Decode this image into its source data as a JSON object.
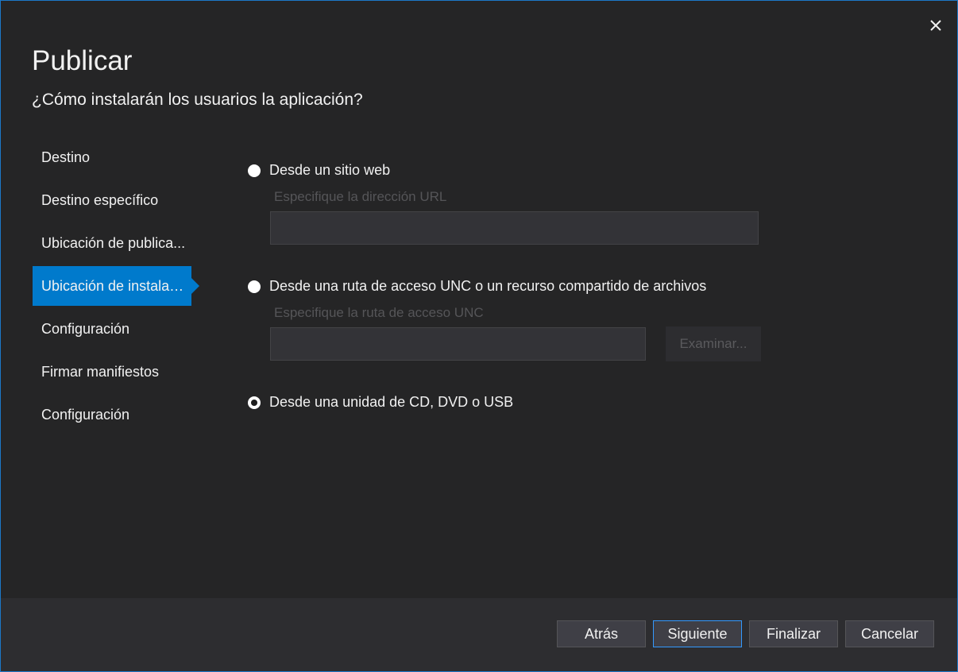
{
  "dialog": {
    "title": "Publicar",
    "subtitle": "¿Cómo instalarán los usuarios la aplicación?"
  },
  "sidebar": {
    "items": [
      {
        "label": "Destino"
      },
      {
        "label": "Destino específico"
      },
      {
        "label": "Ubicación de publica..."
      },
      {
        "label": "Ubicación de instalac..."
      },
      {
        "label": "Configuración"
      },
      {
        "label": "Firmar manifiestos"
      },
      {
        "label": "Configuración"
      }
    ],
    "active_index": 3
  },
  "options": {
    "web": {
      "label": "Desde un sitio web",
      "field_label": "Especifique la dirección URL",
      "value": "",
      "checked": false
    },
    "unc": {
      "label": "Desde una ruta de acceso UNC o un recurso compartido de archivos",
      "field_label": "Especifique la ruta de acceso UNC",
      "value": "",
      "browse_label": "Examinar...",
      "checked": false
    },
    "cd": {
      "label": "Desde una unidad de CD, DVD o USB",
      "checked": true
    }
  },
  "footer": {
    "back_label": "Atrás",
    "next_label": "Siguiente",
    "finish_label": "Finalizar",
    "cancel_label": "Cancelar"
  },
  "colors": {
    "accent": "#007acc",
    "background": "#252526",
    "footer": "#2d2d30",
    "text": "#f1f1f1"
  }
}
